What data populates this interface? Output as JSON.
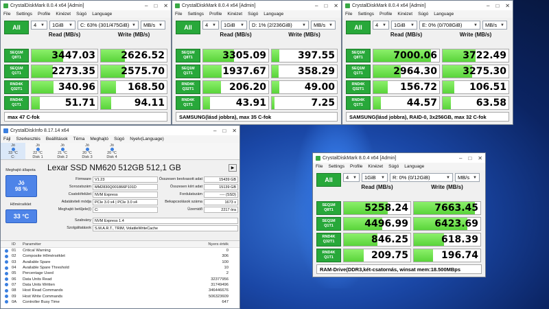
{
  "taskbar_note": "",
  "cdm_windows": [
    {
      "title": "CrystalDiskMark 8.0.4 x64 [Admin]",
      "menu": [
        "File",
        "Settings",
        "Profile",
        "Kinézet",
        "Súgó",
        "Language"
      ],
      "all_label": "All",
      "count": "4",
      "size": "1GiB",
      "drive": "C: 63% (301/475GiB)",
      "unit": "MB/s",
      "read_header": "Read (MB/s)",
      "write_header": "Write (MB/s)",
      "rows": [
        {
          "l1": "SEQ1M",
          "l2": "Q8T1",
          "read": "3447.03",
          "write": "2626.52",
          "rf": 0.48,
          "wf": 0.36
        },
        {
          "l1": "SEQ1M",
          "l2": "Q1T1",
          "read": "2273.35",
          "write": "2575.70",
          "rf": 0.32,
          "wf": 0.36
        },
        {
          "l1": "RND4K",
          "l2": "Q32T1",
          "read": "340.96",
          "write": "168.50",
          "rf": 0.33,
          "wf": 0.23
        },
        {
          "l1": "RND4K",
          "l2": "Q1T1",
          "read": "51.71",
          "write": "94.11",
          "rf": 0.12,
          "wf": 0.16
        }
      ],
      "status": "max 47 C-fok"
    },
    {
      "title": "CrystalDiskMark 8.0.4 x64 [Admin]",
      "menu": [
        "File",
        "Settings",
        "Profile",
        "Kinézet",
        "Súgó",
        "Language"
      ],
      "all_label": "All",
      "count": "4",
      "size": "1GiB",
      "drive": "D: 1% (2/236GiB)",
      "unit": "MB/s",
      "read_header": "Read (MB/s)",
      "write_header": "Write (MB/s)",
      "rows": [
        {
          "l1": "SEQ1M",
          "l2": "Q8T1",
          "read": "3305.09",
          "write": "397.55",
          "rf": 0.47,
          "wf": 0.12
        },
        {
          "l1": "SEQ1M",
          "l2": "Q1T1",
          "read": "1937.67",
          "write": "358.29",
          "rf": 0.28,
          "wf": 0.11
        },
        {
          "l1": "RND4K",
          "l2": "Q32T1",
          "read": "206.20",
          "write": "49.00",
          "rf": 0.27,
          "wf": 0.12
        },
        {
          "l1": "RND4K",
          "l2": "Q1T1",
          "read": "43.91",
          "write": "7.25",
          "rf": 0.11,
          "wf": 0.04
        }
      ],
      "status": "SAMSUNG(lásd jobbra), max 35 C-fok"
    },
    {
      "title": "CrystalDiskMark 8.0.4 x64 [Admin]",
      "menu": [
        "File",
        "Settings",
        "Profile",
        "Kinézet",
        "Súgó",
        "Language"
      ],
      "all_label": "All",
      "count": "4",
      "size": "1GiB",
      "drive": "E: 0% (0/708GiB)",
      "unit": "MB/s",
      "read_header": "Read (MB/s)",
      "write_header": "Write (MB/s)",
      "rows": [
        {
          "l1": "SEQ1M",
          "l2": "Q8T1",
          "read": "7000.06",
          "write": "3722.49",
          "rf": 0.88,
          "wf": 0.5
        },
        {
          "l1": "SEQ1M",
          "l2": "Q1T1",
          "read": "2964.30",
          "write": "3275.30",
          "rf": 0.42,
          "wf": 0.45
        },
        {
          "l1": "RND4K",
          "l2": "Q32T1",
          "read": "156.72",
          "write": "106.51",
          "rf": 0.22,
          "wf": 0.18
        },
        {
          "l1": "RND4K",
          "l2": "Q1T1",
          "read": "44.57",
          "write": "63.58",
          "rf": 0.11,
          "wf": 0.13
        }
      ],
      "status": "SAMSUNG(lásd jobbra), RAID-0, 3x256GB, max 32 C-fok"
    },
    {
      "title": "CrystalDiskMark 8.0.4 x64 [Admin]",
      "menu": [
        "File",
        "Settings",
        "Profile",
        "Kinézet",
        "Súgó",
        "Language"
      ],
      "all_label": "All",
      "count": "4",
      "size": "1GiB",
      "drive": "R: 0% (0/12GiB)",
      "unit": "MB/s",
      "read_header": "Read (MB/s)",
      "write_header": "Write (MB/s)",
      "rows": [
        {
          "l1": "SEQ1M",
          "l2": "Q8T1",
          "read": "5258.24",
          "write": "7663.45",
          "rf": 0.66,
          "wf": 0.92
        },
        {
          "l1": "SEQ1M",
          "l2": "Q1T1",
          "read": "4496.99",
          "write": "6423.69",
          "rf": 0.58,
          "wf": 0.8
        },
        {
          "l1": "RND4K",
          "l2": "Q32T1",
          "read": "846.25",
          "write": "618.39",
          "rf": 0.5,
          "wf": 0.45
        },
        {
          "l1": "RND4K",
          "l2": "Q1T1",
          "read": "209.75",
          "write": "196.74",
          "rf": 0.3,
          "wf": 0.29
        }
      ],
      "status": "RAM-Drive(DDR3,két-csatornás, winsat mem:18.500MBps"
    }
  ],
  "cdi": {
    "title": "CrystalDiskInfo 8.17.14 x64",
    "menu": [
      "Fájl",
      "Szerkesztés",
      "Beállítások",
      "Téma",
      "Meghajtó",
      "Súgó",
      "Nyelv(Language)"
    ],
    "disks": [
      {
        "state": "Jó",
        "temp": "33 °C",
        "name": "C:"
      },
      {
        "state": "Jó",
        "temp": "22 °C",
        "name": "Disk 1"
      },
      {
        "state": "Jó",
        "temp": "21 °C",
        "name": "Disk 2"
      },
      {
        "state": "Jó",
        "temp": "20 °C",
        "name": "Disk 3"
      },
      {
        "state": "Jó",
        "temp": "20 °C",
        "name": "Disk 4"
      }
    ],
    "model": "Lexar SSD NM620 512GB 512,1 GB",
    "health_label": "Meghajtó állapota",
    "health_state": "Jó",
    "health_pct": "98 %",
    "temp_label": "Hőmérséklet",
    "temp_value": "33 °C",
    "left_keys": [
      "Firmware",
      "Sorozatszám",
      "Csatolófelület",
      "Adatátviteli módja",
      "Meghajtó betűjele(i)"
    ],
    "left_vals": [
      "V1.23",
      "MM2830Q001866P101D",
      "NVM Express",
      "PCIe 3.0 x4 | PCIe 3.0 x4",
      "C:"
    ],
    "right_keys": [
      "Összesen beolvasott adat",
      "Összesen kiírt adat",
      "Fordulatszám",
      "Bekapcsolások száma",
      "Üzemidő"
    ],
    "right_vals": [
      "15439 GB",
      "15139 GB",
      "---- (SSD)",
      "1673 x",
      "2217 óra"
    ],
    "std_key": "Szabvány",
    "std_val": "NVM Express 1.4",
    "feat_key": "Szolgáltatások",
    "feat_val": "S.M.A.R.T., TRIM, VolatileWriteCache",
    "smart_headers": {
      "id": "ID",
      "name": "Paraméter",
      "raw": "Nyers érték"
    },
    "smart_rows": [
      {
        "id": "01",
        "name": "Critical Warning",
        "raw": "0"
      },
      {
        "id": "02",
        "name": "Composite Hőmérséklet",
        "raw": "306"
      },
      {
        "id": "03",
        "name": "Available Spare",
        "raw": "100"
      },
      {
        "id": "04",
        "name": "Available Spare Threshold",
        "raw": "10"
      },
      {
        "id": "05",
        "name": "Percentage Used",
        "raw": "2"
      },
      {
        "id": "06",
        "name": "Data Units Read",
        "raw": "32377956"
      },
      {
        "id": "07",
        "name": "Data Units Written",
        "raw": "31749496"
      },
      {
        "id": "08",
        "name": "Host Read Commands",
        "raw": "346446676"
      },
      {
        "id": "09",
        "name": "Host Write Commands",
        "raw": "506323609"
      },
      {
        "id": "0A",
        "name": "Controller Busy Time",
        "raw": "647"
      }
    ]
  },
  "colors": {
    "accent_green": "#28a83a",
    "bar_green": "#59d43a",
    "health_blue": "#4e84e8"
  }
}
